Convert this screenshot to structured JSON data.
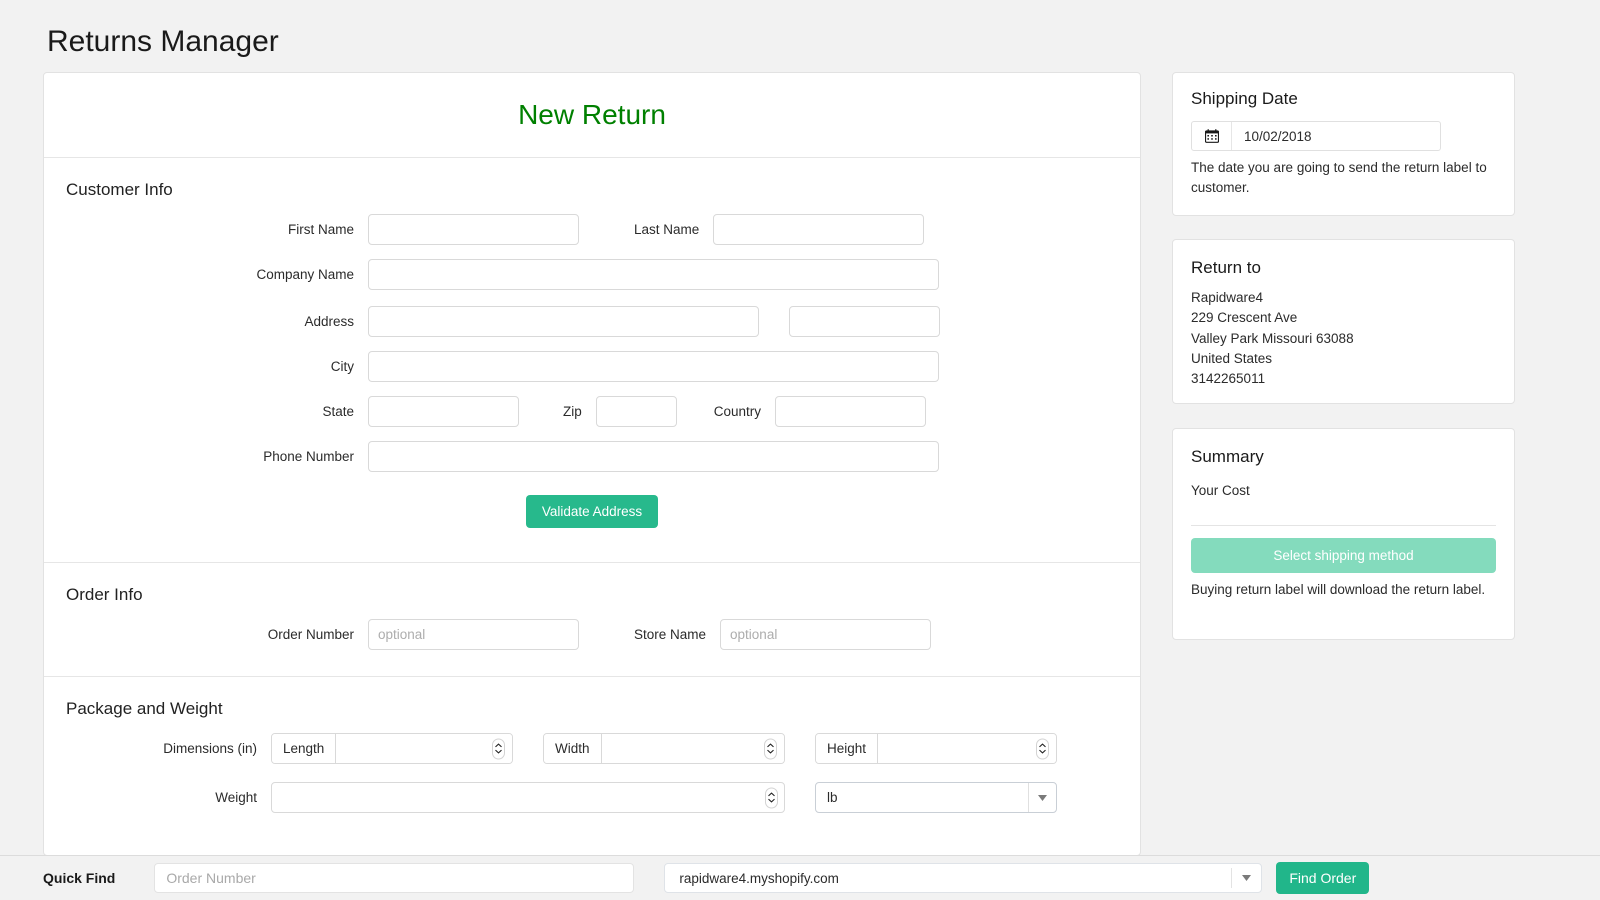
{
  "page": {
    "title": "Returns Manager"
  },
  "main_card": {
    "header_title": "New Return",
    "customer_info": {
      "section_title": "Customer Info",
      "first_name_label": "First Name",
      "first_name_value": "",
      "last_name_label": "Last Name",
      "last_name_value": "",
      "company_name_label": "Company Name",
      "company_name_value": "",
      "address_label": "Address",
      "address_value": "",
      "address2_value": "",
      "city_label": "City",
      "city_value": "",
      "state_label": "State",
      "state_value": "",
      "zip_label": "Zip",
      "zip_value": "",
      "country_label": "Country",
      "country_value": "",
      "phone_label": "Phone Number",
      "phone_value": "",
      "validate_button": "Validate Address"
    },
    "order_info": {
      "section_title": "Order Info",
      "order_number_label": "Order Number",
      "order_number_placeholder": "optional",
      "order_number_value": "",
      "store_name_label": "Store Name",
      "store_name_placeholder": "optional",
      "store_name_value": ""
    },
    "package_weight": {
      "section_title": "Package and Weight",
      "dimensions_label": "Dimensions (in)",
      "length_prefix": "Length",
      "length_value": "",
      "width_prefix": "Width",
      "width_value": "",
      "height_prefix": "Height",
      "height_value": "",
      "weight_label": "Weight",
      "weight_value": "",
      "weight_unit": "lb"
    }
  },
  "sidebar": {
    "shipping_date": {
      "title": "Shipping Date",
      "icon": "calendar-icon",
      "value": "10/02/2018",
      "note": "The date you are going to send the return label to customer."
    },
    "return_to": {
      "title": "Return to",
      "lines": [
        "Rapidware4",
        "229 Crescent Ave",
        "Valley Park Missouri 63088",
        "United States",
        "3142265011"
      ]
    },
    "summary": {
      "title": "Summary",
      "cost_label": "Your Cost",
      "select_button": "Select shipping method",
      "note": "Buying return label will download the return label."
    }
  },
  "bottom_bar": {
    "quick_find_label": "Quick Find",
    "order_number_placeholder": "Order Number",
    "order_number_value": "",
    "store_selected": "rapidware4.myshopify.com",
    "find_order_button": "Find Order"
  },
  "colors": {
    "page_background": "#f2f2f2",
    "card_background": "#ffffff",
    "header_title_green": "#008000",
    "accent_teal": "#27b98c",
    "accent_teal_light": "#84dbbd",
    "find_order_green": "#21b68a",
    "border": "#e2e2e2"
  }
}
